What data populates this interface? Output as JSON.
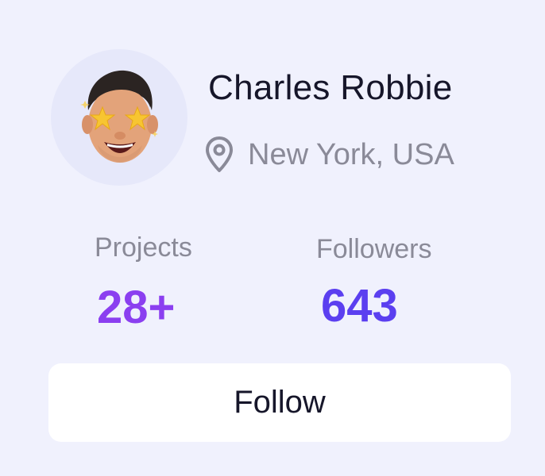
{
  "profile": {
    "name": "Charles Robbie",
    "location": "New York, USA",
    "avatar_icon": "memoji-avatar-star-eyes",
    "location_icon": "map-pin-icon"
  },
  "stats": {
    "projects_label": "Projects",
    "projects_value": "28+",
    "followers_label": "Followers",
    "followers_value": "643"
  },
  "actions": {
    "follow_label": "Follow"
  },
  "colors": {
    "background": "#f0f1fd",
    "avatar_circle": "#e6e8fa",
    "name_text": "#16162a",
    "muted_text": "#8a8a98",
    "projects_accent": "#8b3ff0",
    "followers_accent": "#5b3ff0",
    "button_bg": "#ffffff"
  }
}
